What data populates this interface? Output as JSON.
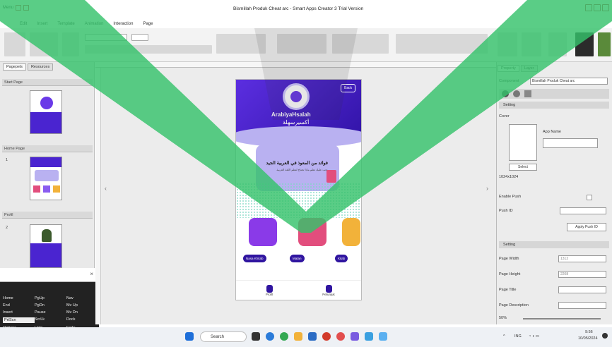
{
  "app": {
    "title": "Bismillah Produk Cheat arc - Smart Apps Creator 3 Trial Version",
    "quick_access": [
      "Menu"
    ],
    "menus": [
      "Edit",
      "Insert",
      "Template",
      "Animation",
      "Interaction",
      "Page"
    ]
  },
  "left_panel": {
    "tabs": [
      "Pagepels",
      "Resources"
    ],
    "sections": [
      {
        "label": "Start Page"
      },
      {
        "label": "Home Page",
        "number": "1"
      },
      {
        "label": "Profil",
        "number": "2"
      }
    ]
  },
  "keyboard_popup": {
    "keys": [
      "Home",
      "PgUp",
      "Nav",
      "End",
      "PgDn",
      "Mv Up",
      "Insert",
      "Pause",
      "Mv Dn",
      "PrtScn",
      "ScrLk",
      "Dock",
      "Options",
      "Help",
      "Fade"
    ],
    "selected": "PrtScn"
  },
  "phone": {
    "top_button": "Back",
    "brand": "ArabiyaHsalah",
    "tagline": "أكسيرسهلة",
    "card_title": "فوائد من المعوذ في العربية الجيد",
    "card_subtitle": "يجب عليك تعلم ماذا تحتاج لتعلم اللغة العربية",
    "pills": [
      "Nasa Khitab",
      "Matan",
      "Kitab"
    ],
    "nav": [
      "Profil",
      "Petunjuk"
    ]
  },
  "right_panel": {
    "tabs": [
      "Property",
      "Layer"
    ],
    "component": "Component",
    "component_value": "Bismillah Produk Cheat arc",
    "setting_header": "Setting",
    "cover_label": "Cover",
    "app_name_label": "App Name",
    "select_label": "Select",
    "size_hint": "1024x1024",
    "enable_push_label": "Enable Push",
    "push_id_label": "Push ID",
    "apply_push_label": "Apply Push ID",
    "editing_header": "Setting",
    "page_width_label": "Page Width",
    "page_width_value": "1312",
    "page_height_label": "Page Height",
    "page_height_value": "2208",
    "page_title_label": "Page Title",
    "page_desc_label": "Page Description",
    "zoom": "50%"
  },
  "taskbar": {
    "search_placeholder": "Search",
    "time": "9:56",
    "date": "10/05/2024",
    "lang": "ING"
  },
  "colors": {
    "accent": "#5b2ee0",
    "dark_purple": "#3015a0",
    "card_lavender": "#b9b1f1",
    "watermark_green": "#36c26b"
  }
}
